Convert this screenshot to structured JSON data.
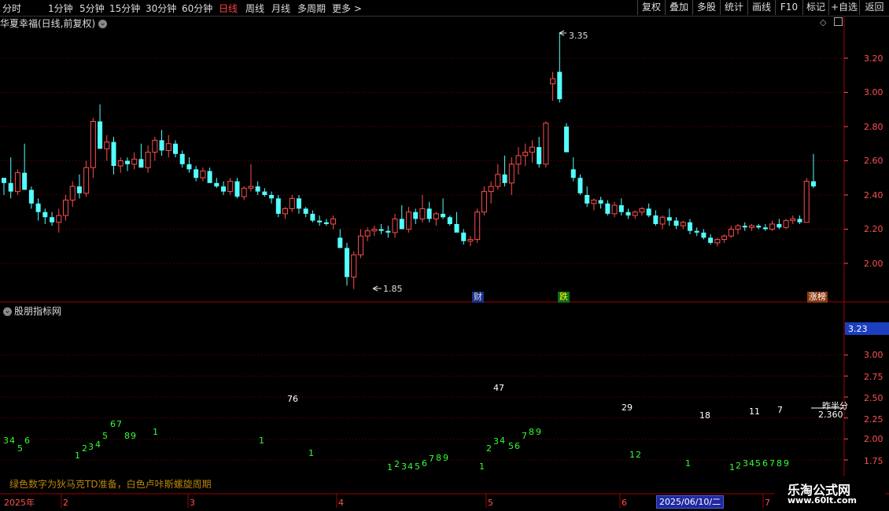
{
  "toolbar": {
    "timeframes": [
      "分时",
      "1分钟",
      "5分钟",
      "15分钟",
      "30分钟",
      "60分钟",
      "日线",
      "周线",
      "月线",
      "多周期",
      "更多"
    ],
    "active": "日线",
    "right_buttons": [
      "复权",
      "叠加",
      "多股",
      "统计",
      "画线",
      "F10",
      "标记",
      "+自选",
      "返回"
    ]
  },
  "chart_title": "华夏幸福(日线,前复权)",
  "indicator_title": "股朋指标网",
  "note_text": "绿色数字为狄马克TD准备，白色卢咔斯螺旋周期",
  "price_axis": {
    "ticks": [
      "3.20",
      "3.00",
      "2.80",
      "2.60",
      "2.40",
      "2.20",
      "2.00"
    ]
  },
  "indicator_axis": {
    "current": "3.23",
    "ticks": [
      "3.00",
      "2.75",
      "2.50",
      "2.25",
      "2.00",
      "1.75"
    ]
  },
  "annotations": {
    "high": "3.35",
    "low": "1.85"
  },
  "badges": {
    "b1": "财",
    "b2": "跌",
    "b3": "涨榜"
  },
  "time_axis": {
    "labels": [
      "2025年",
      "2",
      "3",
      "4",
      "5",
      "6",
      "7"
    ],
    "selected_date": "2025/06/10/二"
  },
  "indicator_labels": {
    "white": [
      "76",
      "47",
      "29",
      "18",
      "11",
      "7",
      "2.360",
      "昨半分"
    ],
    "green": [
      "3",
      "4",
      "5",
      "6",
      "6",
      "7",
      "8",
      "9",
      "1",
      "1",
      "2",
      "3",
      "4",
      "5",
      "1",
      "1",
      "1",
      "2",
      "3",
      "4",
      "5",
      "6",
      "7",
      "8",
      "9",
      "1",
      "2",
      "3",
      "4",
      "5",
      "6",
      "7",
      "8",
      "9",
      "1",
      "2",
      "1",
      "1",
      "2",
      "3",
      "4",
      "5",
      "6",
      "7",
      "8",
      "9"
    ]
  },
  "watermark": {
    "line1": "乐淘公式网",
    "line2": "www.60lt.com"
  },
  "colors": {
    "up": "#ff4d4d",
    "down": "#54ffff",
    "grid": "#7a0000",
    "axis_text": "#ff5050",
    "green_digit": "#33ff33",
    "current_price_bg": "#1c3fbf"
  },
  "chart_data": {
    "type": "candlestick",
    "x_labels": [
      "2025年",
      "2",
      "3",
      "4",
      "5",
      "6",
      "7"
    ],
    "y_range": [
      1.8,
      3.35
    ],
    "ohlc": [
      [
        2.5,
        2.5,
        2.4,
        2.47
      ],
      [
        2.47,
        2.62,
        2.38,
        2.42
      ],
      [
        2.42,
        2.55,
        2.4,
        2.53
      ],
      [
        2.53,
        2.7,
        2.48,
        2.43
      ],
      [
        2.43,
        2.45,
        2.32,
        2.35
      ],
      [
        2.35,
        2.38,
        2.25,
        2.3
      ],
      [
        2.3,
        2.32,
        2.23,
        2.27
      ],
      [
        2.27,
        2.3,
        2.22,
        2.24
      ],
      [
        2.24,
        2.32,
        2.18,
        2.28
      ],
      [
        2.28,
        2.4,
        2.25,
        2.37
      ],
      [
        2.37,
        2.48,
        2.33,
        2.45
      ],
      [
        2.45,
        2.52,
        2.38,
        2.41
      ],
      [
        2.41,
        2.6,
        2.39,
        2.56
      ],
      [
        2.56,
        2.85,
        2.5,
        2.83
      ],
      [
        2.83,
        2.93,
        2.7,
        2.67
      ],
      [
        2.67,
        2.75,
        2.6,
        2.71
      ],
      [
        2.71,
        2.74,
        2.52,
        2.57
      ],
      [
        2.57,
        2.62,
        2.53,
        2.6
      ],
      [
        2.6,
        2.62,
        2.54,
        2.58
      ],
      [
        2.58,
        2.65,
        2.55,
        2.61
      ],
      [
        2.61,
        2.7,
        2.56,
        2.56
      ],
      [
        2.56,
        2.69,
        2.53,
        2.65
      ],
      [
        2.65,
        2.74,
        2.6,
        2.72
      ],
      [
        2.72,
        2.78,
        2.63,
        2.66
      ],
      [
        2.66,
        2.75,
        2.62,
        2.7
      ],
      [
        2.7,
        2.72,
        2.62,
        2.64
      ],
      [
        2.64,
        2.66,
        2.56,
        2.58
      ],
      [
        2.58,
        2.62,
        2.53,
        2.55
      ],
      [
        2.55,
        2.57,
        2.48,
        2.5
      ],
      [
        2.5,
        2.56,
        2.48,
        2.54
      ],
      [
        2.54,
        2.56,
        2.47,
        2.47
      ],
      [
        2.47,
        2.5,
        2.44,
        2.45
      ],
      [
        2.45,
        2.48,
        2.4,
        2.42
      ],
      [
        2.42,
        2.5,
        2.4,
        2.48
      ],
      [
        2.48,
        2.5,
        2.38,
        2.39
      ],
      [
        2.39,
        2.45,
        2.37,
        2.44
      ],
      [
        2.44,
        2.58,
        2.42,
        2.45
      ],
      [
        2.45,
        2.48,
        2.4,
        2.42
      ],
      [
        2.42,
        2.44,
        2.39,
        2.4
      ],
      [
        2.4,
        2.42,
        2.35,
        2.38
      ],
      [
        2.38,
        2.4,
        2.27,
        2.29
      ],
      [
        2.29,
        2.33,
        2.26,
        2.32
      ],
      [
        2.32,
        2.4,
        2.3,
        2.38
      ],
      [
        2.38,
        2.4,
        2.29,
        2.32
      ],
      [
        2.32,
        2.33,
        2.27,
        2.29
      ],
      [
        2.29,
        2.31,
        2.24,
        2.25
      ],
      [
        2.25,
        2.28,
        2.22,
        2.24
      ],
      [
        2.24,
        2.26,
        2.22,
        2.23
      ],
      [
        2.23,
        2.28,
        2.2,
        2.26
      ],
      [
        2.15,
        2.2,
        2.09,
        2.09
      ],
      [
        2.09,
        2.12,
        1.87,
        1.92
      ],
      [
        1.92,
        2.07,
        1.85,
        2.05
      ],
      [
        2.05,
        2.2,
        2.03,
        2.16
      ],
      [
        2.16,
        2.21,
        2.13,
        2.19
      ],
      [
        2.19,
        2.22,
        2.16,
        2.2
      ],
      [
        2.2,
        2.23,
        2.17,
        2.19
      ],
      [
        2.19,
        2.22,
        2.15,
        2.18
      ],
      [
        2.18,
        2.29,
        2.15,
        2.26
      ],
      [
        2.26,
        2.34,
        2.2,
        2.2
      ],
      [
        2.2,
        2.33,
        2.18,
        2.3
      ],
      [
        2.3,
        2.32,
        2.23,
        2.26
      ],
      [
        2.26,
        2.4,
        2.24,
        2.32
      ],
      [
        2.32,
        2.36,
        2.24,
        2.26
      ],
      [
        2.26,
        2.3,
        2.22,
        2.29
      ],
      [
        2.29,
        2.38,
        2.26,
        2.27
      ],
      [
        2.27,
        2.28,
        2.22,
        2.23
      ],
      [
        2.23,
        2.3,
        2.2,
        2.18
      ],
      [
        2.18,
        2.2,
        2.11,
        2.13
      ],
      [
        2.13,
        2.16,
        2.1,
        2.14
      ],
      [
        2.14,
        2.32,
        2.12,
        2.3
      ],
      [
        2.3,
        2.45,
        2.28,
        2.42
      ],
      [
        2.42,
        2.48,
        2.35,
        2.45
      ],
      [
        2.45,
        2.58,
        2.43,
        2.52
      ],
      [
        2.52,
        2.63,
        2.45,
        2.47
      ],
      [
        2.47,
        2.62,
        2.4,
        2.58
      ],
      [
        2.58,
        2.68,
        2.52,
        2.63
      ],
      [
        2.63,
        2.7,
        2.57,
        2.65
      ],
      [
        2.65,
        2.72,
        2.59,
        2.68
      ],
      [
        2.68,
        2.74,
        2.56,
        2.58
      ],
      [
        2.58,
        2.83,
        2.56,
        2.82
      ],
      [
        3.05,
        3.12,
        2.95,
        3.08
      ],
      [
        3.12,
        3.35,
        2.94,
        2.96
      ],
      [
        2.8,
        2.82,
        2.65,
        2.65
      ],
      [
        2.55,
        2.62,
        2.48,
        2.5
      ],
      [
        2.5,
        2.52,
        2.4,
        2.41
      ],
      [
        2.4,
        2.45,
        2.33,
        2.35
      ],
      [
        2.35,
        2.38,
        2.31,
        2.37
      ],
      [
        2.37,
        2.39,
        2.32,
        2.35
      ],
      [
        2.35,
        2.37,
        2.28,
        2.29
      ],
      [
        2.29,
        2.36,
        2.27,
        2.34
      ],
      [
        2.34,
        2.38,
        2.28,
        2.3
      ],
      [
        2.3,
        2.32,
        2.26,
        2.28
      ],
      [
        2.28,
        2.31,
        2.26,
        2.3
      ],
      [
        2.3,
        2.33,
        2.28,
        2.32
      ],
      [
        2.32,
        2.35,
        2.27,
        2.28
      ],
      [
        2.28,
        2.31,
        2.22,
        2.23
      ],
      [
        2.23,
        2.28,
        2.2,
        2.27
      ],
      [
        2.27,
        2.32,
        2.22,
        2.25
      ],
      [
        2.25,
        2.27,
        2.2,
        2.22
      ],
      [
        2.22,
        2.25,
        2.2,
        2.24
      ],
      [
        2.24,
        2.26,
        2.17,
        2.19
      ],
      [
        2.19,
        2.21,
        2.16,
        2.18
      ],
      [
        2.18,
        2.2,
        2.14,
        2.15
      ],
      [
        2.15,
        2.17,
        2.11,
        2.12
      ],
      [
        2.12,
        2.15,
        2.1,
        2.14
      ],
      [
        2.14,
        2.17,
        2.12,
        2.16
      ],
      [
        2.16,
        2.22,
        2.15,
        2.2
      ],
      [
        2.2,
        2.23,
        2.17,
        2.22
      ],
      [
        2.22,
        2.24,
        2.19,
        2.21
      ],
      [
        2.21,
        2.23,
        2.19,
        2.22
      ],
      [
        2.22,
        2.23,
        2.2,
        2.21
      ],
      [
        2.21,
        2.23,
        2.19,
        2.2
      ],
      [
        2.2,
        2.25,
        2.19,
        2.23
      ],
      [
        2.23,
        2.26,
        2.2,
        2.21
      ],
      [
        2.21,
        2.26,
        2.2,
        2.25
      ],
      [
        2.25,
        2.28,
        2.23,
        2.26
      ],
      [
        2.26,
        2.28,
        2.23,
        2.24
      ],
      [
        2.24,
        2.5,
        2.24,
        2.48
      ],
      [
        2.48,
        2.64,
        2.44,
        2.45
      ]
    ]
  }
}
